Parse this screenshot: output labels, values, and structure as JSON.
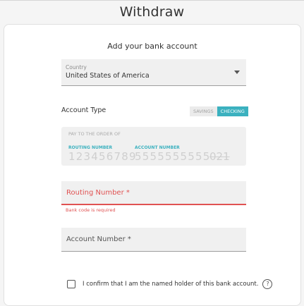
{
  "header": {
    "title": "Withdraw"
  },
  "form": {
    "subtitle": "Add your bank account",
    "country": {
      "label": "Country",
      "value": "United States of America"
    },
    "account_type": {
      "label": "Account Type",
      "options": [
        "SAVINGS",
        "CHECKING"
      ],
      "selected": "CHECKING"
    },
    "check": {
      "pay_to": "PAY TO THE ORDER OF",
      "routing_label": "ROUTING NUMBER",
      "routing_example": "123456789",
      "account_label": "ACCOUNT NUMBER",
      "account_example": "5555555555",
      "check_number": "021"
    },
    "routing_field": {
      "placeholder": "Routing Number *",
      "error": "Bank code is required"
    },
    "account_field": {
      "placeholder": "Account Number *"
    },
    "confirm": {
      "text": "I confirm that I am the named holder of this bank account."
    },
    "help_icon": "?"
  },
  "colors": {
    "accent": "#3bb1bf",
    "error": "#e05252"
  }
}
